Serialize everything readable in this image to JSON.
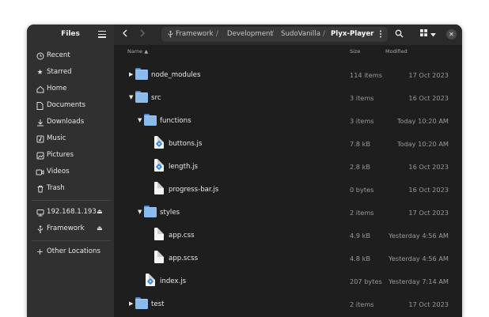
{
  "sidebar": {
    "title": "Files",
    "menu_icon": "hamburger-menu-icon",
    "places": [
      {
        "label": "Recent",
        "icon": "clock-icon"
      },
      {
        "label": "Starred",
        "icon": "star-icon"
      },
      {
        "label": "Home",
        "icon": "home-icon"
      },
      {
        "label": "Documents",
        "icon": "document-icon"
      },
      {
        "label": "Downloads",
        "icon": "download-icon"
      },
      {
        "label": "Music",
        "icon": "music-icon"
      },
      {
        "label": "Pictures",
        "icon": "pictures-icon"
      },
      {
        "label": "Videos",
        "icon": "video-icon"
      },
      {
        "label": "Trash",
        "icon": "trash-icon"
      }
    ],
    "devices": [
      {
        "label": "192.168.1.193",
        "icon": "network-drive-icon",
        "eject_icon": "eject-icon"
      },
      {
        "label": "Framework",
        "icon": "usb-icon",
        "eject_icon": "eject-icon"
      }
    ],
    "other": {
      "label": "Other Locations",
      "icon": "plus-icon"
    }
  },
  "toolbar": {
    "back_icon": "chevron-left-icon",
    "forward_icon": "chevron-right-icon",
    "path_icon": "usb-icon",
    "breadcrumbs": [
      "Framework",
      "Development",
      "SudoVanilla",
      "Plyx-Player"
    ],
    "separator": "/",
    "path_menu_icon": "more-vertical-icon",
    "search_icon": "search-icon",
    "view_icon": "grid-view-icon",
    "view_dropdown_icon": "chevron-down-icon",
    "close_icon": "close-icon"
  },
  "columns": {
    "name": "Name",
    "size": "Size",
    "modified": "Modified",
    "sort_indicator": "▲"
  },
  "files": [
    {
      "name": "node_modules",
      "type": "folder",
      "depth": 0,
      "expander": "collapsed",
      "size": "114 items",
      "modified": "17 Oct 2023"
    },
    {
      "name": "src",
      "type": "folder",
      "depth": 0,
      "expander": "expanded",
      "size": "3 items",
      "modified": "16 Oct 2023"
    },
    {
      "name": "functions",
      "type": "folder",
      "depth": 1,
      "expander": "expanded",
      "size": "3 items",
      "modified": "Today 10:20 AM"
    },
    {
      "name": "buttons.js",
      "type": "js",
      "depth": 2,
      "expander": "none",
      "size": "7.8 kB",
      "modified": "Today 10:20 AM"
    },
    {
      "name": "length.js",
      "type": "js",
      "depth": 2,
      "expander": "none",
      "size": "2.8 kB",
      "modified": "16 Oct 2023"
    },
    {
      "name": "progress-bar.js",
      "type": "file",
      "depth": 2,
      "expander": "none",
      "size": "0 bytes",
      "modified": "16 Oct 2023"
    },
    {
      "name": "styles",
      "type": "folder",
      "depth": 1,
      "expander": "expanded",
      "size": "2 items",
      "modified": "17 Oct 2023"
    },
    {
      "name": "app.css",
      "type": "file",
      "depth": 2,
      "expander": "none",
      "size": "4.9 kB",
      "modified": "Yesterday 4:56 AM"
    },
    {
      "name": "app.scss",
      "type": "file",
      "depth": 2,
      "expander": "none",
      "size": "4.8 kB",
      "modified": "Yesterday 4:56 AM"
    },
    {
      "name": "index.js",
      "type": "js",
      "depth": 1,
      "expander": "none",
      "size": "207 bytes",
      "modified": "Yesterday 7:14 AM"
    },
    {
      "name": "test",
      "type": "folder",
      "depth": 0,
      "expander": "collapsed",
      "size": "2 items",
      "modified": "17 Oct 2023"
    }
  ],
  "colors": {
    "window_bg": "#1e1e1e",
    "sidebar_bg": "#303030",
    "folder_blue": "#8bbbed",
    "js_badge": "#3c8be0"
  }
}
